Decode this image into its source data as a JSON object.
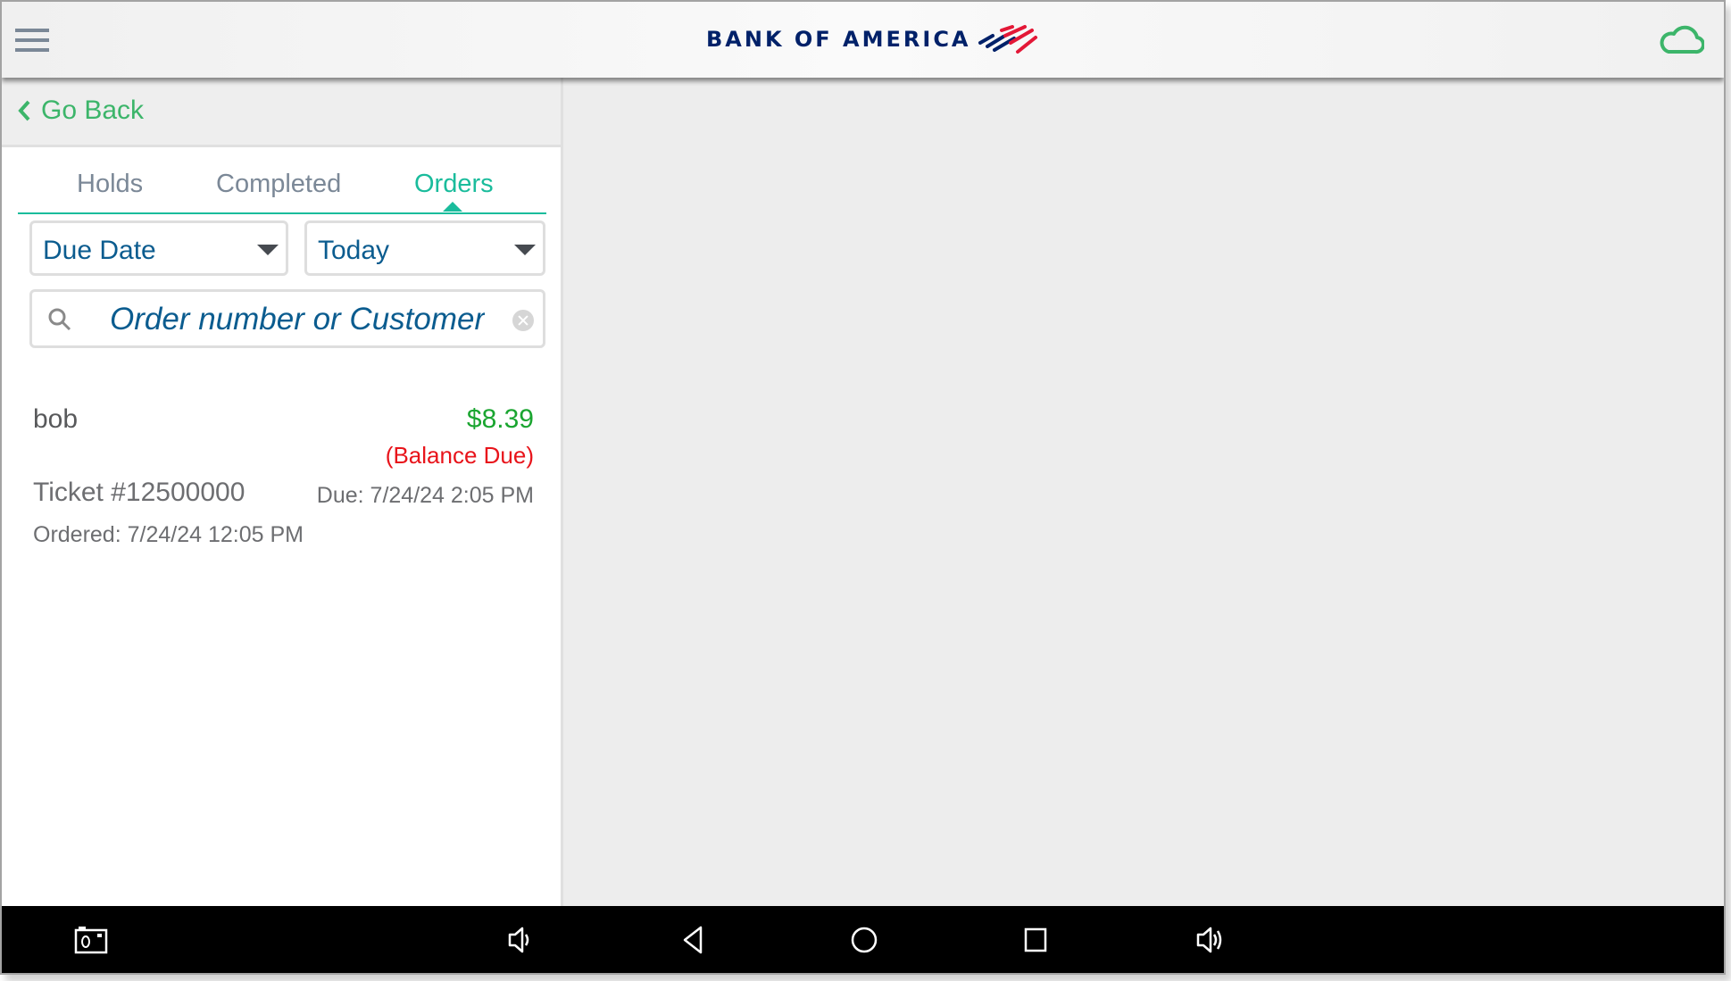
{
  "header": {
    "menu_icon": "hamburger-menu-icon",
    "logo_text": "BANK OF AMERICA",
    "logo_flag_icon": "bank-of-america-flag-icon",
    "sync_icon": "cloud-icon",
    "colors": {
      "brand_blue": "#012169",
      "brand_red": "#e31837",
      "cloud_green": "#3cb56a"
    }
  },
  "left_panel": {
    "go_back_label": "Go Back",
    "tabs": [
      {
        "label": "Holds",
        "active": false
      },
      {
        "label": "Completed",
        "active": false
      },
      {
        "label": "Orders",
        "active": true
      }
    ],
    "filters": {
      "sort_by": {
        "value": "Due Date"
      },
      "date_range": {
        "value": "Today"
      }
    },
    "search": {
      "placeholder": "Order number or Customer",
      "value": ""
    },
    "orders": [
      {
        "customer": "bob",
        "amount": "$8.39",
        "status": "(Balance Due)",
        "ticket": "Ticket #12500000",
        "due": "Due: 7/24/24 2:05 PM",
        "ordered": "Ordered: 7/24/24 12:05 PM"
      }
    ],
    "colors": {
      "accent_teal": "#1abc9c",
      "amount_green": "#1aa530",
      "balance_red": "#e8141b",
      "link_green": "#3cb56a"
    }
  },
  "navbar": {
    "buttons": [
      {
        "name": "screenshot",
        "icon": "camera-icon"
      },
      {
        "name": "volume-down",
        "icon": "volume-down-icon"
      },
      {
        "name": "back",
        "icon": "back-triangle-icon"
      },
      {
        "name": "home",
        "icon": "home-circle-icon"
      },
      {
        "name": "recents",
        "icon": "recents-square-icon"
      },
      {
        "name": "volume-up",
        "icon": "volume-up-icon"
      }
    ]
  }
}
